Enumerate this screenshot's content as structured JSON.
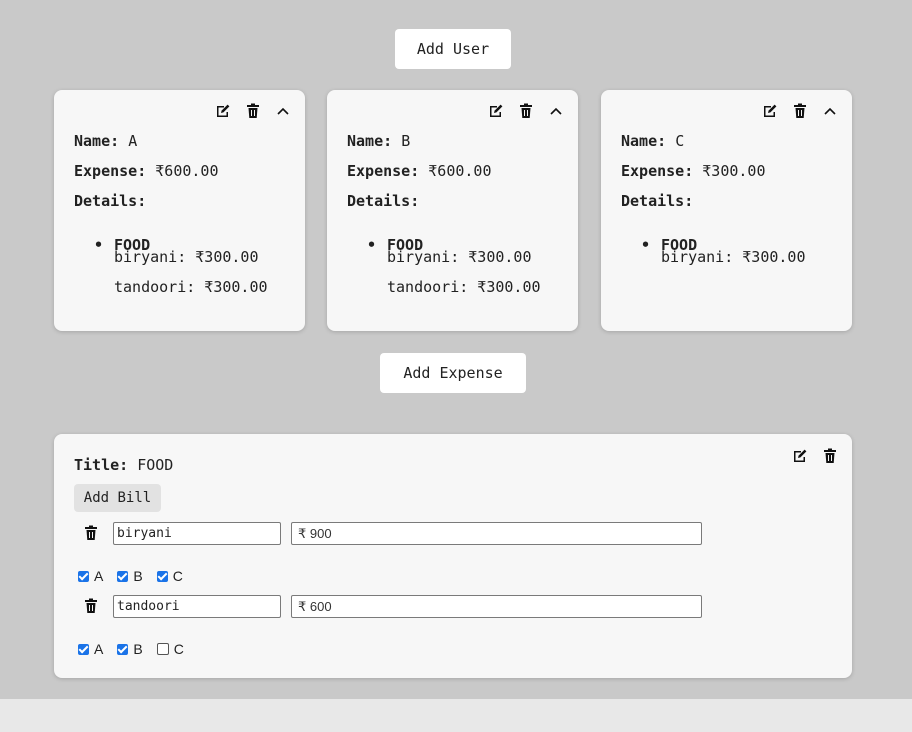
{
  "actions": {
    "add_user_label": "Add User",
    "add_expense_label": "Add Expense"
  },
  "users": [
    {
      "name_label": "Name:",
      "name": "A",
      "expense_label": "Expense:",
      "expense": "₹600.00",
      "details_label": "Details:",
      "category": "FOOD",
      "bills": [
        "biryani: ₹300.00",
        "tandoori: ₹300.00"
      ]
    },
    {
      "name_label": "Name:",
      "name": "B",
      "expense_label": "Expense:",
      "expense": "₹600.00",
      "details_label": "Details:",
      "category": "FOOD",
      "bills": [
        "biryani: ₹300.00",
        "tandoori: ₹300.00"
      ]
    },
    {
      "name_label": "Name:",
      "name": "C",
      "expense_label": "Expense:",
      "expense": "₹300.00",
      "details_label": "Details:",
      "category": "FOOD",
      "bills": [
        "biryani: ₹300.00"
      ]
    }
  ],
  "expense": {
    "title_label": "Title:",
    "title": "FOOD",
    "add_bill_label": "Add Bill",
    "bills": [
      {
        "name": "biryani",
        "amount": "₹ 900",
        "participants": [
          {
            "label": "A",
            "checked": true
          },
          {
            "label": "B",
            "checked": true
          },
          {
            "label": "C",
            "checked": true
          }
        ]
      },
      {
        "name": "tandoori",
        "amount": "₹ 600",
        "participants": [
          {
            "label": "A",
            "checked": true
          },
          {
            "label": "B",
            "checked": true
          },
          {
            "label": "C",
            "checked": false
          }
        ]
      }
    ]
  },
  "icons": {
    "edit": "edit-icon",
    "delete": "trash-icon",
    "collapse": "chevron-up-icon"
  },
  "colors": {
    "background": "#c9c9c9",
    "card": "#f7f7f7",
    "checkbox_accent": "#1a73e8"
  }
}
